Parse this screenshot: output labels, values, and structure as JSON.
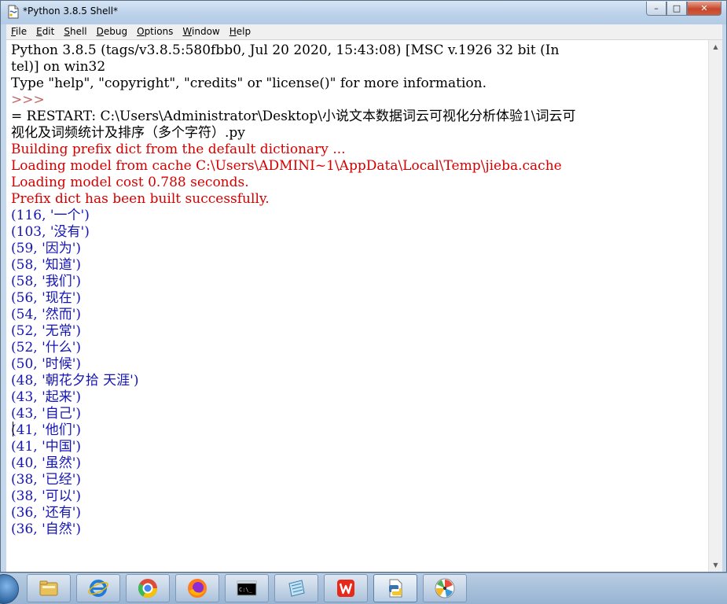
{
  "window": {
    "title": "*Python 3.8.5 Shell*",
    "controls": {
      "minimize": "–",
      "maximize": "□",
      "close": "✕"
    }
  },
  "menu": {
    "items": [
      "File",
      "Edit",
      "Shell",
      "Debug",
      "Options",
      "Window",
      "Help"
    ]
  },
  "shell": {
    "lines": [
      {
        "text": "Python 3.8.5 (tags/v3.8.5:580fbb0, Jul 20 2020, 15:43:08) [MSC v.1926 32 bit (In",
        "style": "black"
      },
      {
        "text": "tel)] on win32",
        "style": "black"
      },
      {
        "text": "Type \"help\", \"copyright\", \"credits\" or \"license()\" for more information.",
        "style": "black"
      },
      {
        "text": ">>>",
        "style": "prompt"
      },
      {
        "text": "= RESTART: C:\\Users\\Administrator\\Desktop\\小说文本数据词云可视化分析体验1\\词云可",
        "style": "black"
      },
      {
        "text": "视化及词频统计及排序（多个字符）.py",
        "style": "black"
      },
      {
        "text": "Building prefix dict from the default dictionary ...",
        "style": "red"
      },
      {
        "text": "Loading model from cache C:\\Users\\ADMINI~1\\AppData\\Local\\Temp\\jieba.cache",
        "style": "red"
      },
      {
        "text": "Loading model cost 0.788 seconds.",
        "style": "red"
      },
      {
        "text": "Prefix dict has been built successfully.",
        "style": "red"
      },
      {
        "text": "(116, '一个')",
        "style": "blue"
      },
      {
        "text": "(103, '没有')",
        "style": "blue"
      },
      {
        "text": "(59, '因为')",
        "style": "blue"
      },
      {
        "text": "(58, '知道')",
        "style": "blue"
      },
      {
        "text": "(58, '我们')",
        "style": "blue"
      },
      {
        "text": "(56, '现在')",
        "style": "blue"
      },
      {
        "text": "(54, '然而')",
        "style": "blue"
      },
      {
        "text": "(52, '无常')",
        "style": "blue"
      },
      {
        "text": "(52, '什么')",
        "style": "blue"
      },
      {
        "text": "(50, '时候')",
        "style": "blue"
      },
      {
        "text": "(48, '朝花夕拾 天涯')",
        "style": "blue"
      },
      {
        "text": "(43, '起来')",
        "style": "blue"
      },
      {
        "text": "(43, '自己')",
        "style": "blue"
      },
      {
        "text": "(41, '他们')",
        "style": "blue"
      },
      {
        "text": "(41, '中国')",
        "style": "blue"
      },
      {
        "text": "(40, '虽然')",
        "style": "blue"
      },
      {
        "text": "(38, '已经')",
        "style": "blue"
      },
      {
        "text": "(38, '可以')",
        "style": "blue"
      },
      {
        "text": "(36, '还有')",
        "style": "blue"
      },
      {
        "text": "(36, '自然')",
        "style": "blue"
      }
    ]
  },
  "taskbar": {
    "apps": [
      {
        "name": "file-explorer",
        "icon": "folder-icon",
        "active": false
      },
      {
        "name": "internet-explorer",
        "icon": "ie-icon",
        "active": false
      },
      {
        "name": "chrome",
        "icon": "chrome-icon",
        "active": false
      },
      {
        "name": "firefox",
        "icon": "firefox-icon",
        "active": false
      },
      {
        "name": "command-prompt",
        "icon": "cmd-icon",
        "active": false
      },
      {
        "name": "notepad",
        "icon": "notepad-icon",
        "active": false
      },
      {
        "name": "wps-office",
        "icon": "wps-icon",
        "active": false
      },
      {
        "name": "python-idle",
        "icon": "python-idle-icon",
        "active": true
      },
      {
        "name": "paint-tool",
        "icon": "pinwheel-icon",
        "active": false
      }
    ]
  },
  "colors": {
    "stdout": "#1414b4",
    "stderr": "#d40000",
    "prompt": "#c46161",
    "text": "#000000"
  }
}
